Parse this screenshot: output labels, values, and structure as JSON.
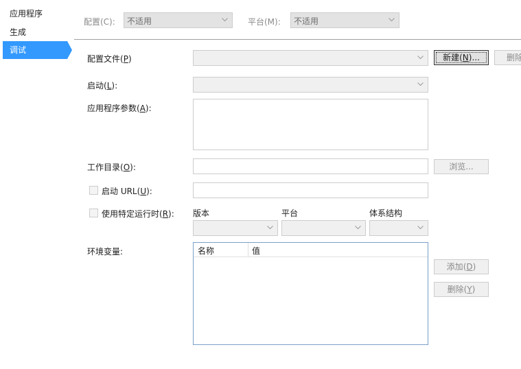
{
  "sidebar": {
    "items": [
      {
        "label": "应用程序",
        "active": false
      },
      {
        "label": "生成",
        "active": false
      },
      {
        "label": "调试",
        "active": true
      }
    ]
  },
  "top": {
    "config_label": "配置(C):",
    "config_value": "不适用",
    "platform_label": "平台(M):",
    "platform_value": "不适用"
  },
  "profile": {
    "label": "配置文件",
    "accel": "P",
    "value": "",
    "new_button": "新建",
    "new_accel": "N",
    "new_suffix": "...",
    "delete_button": "删除"
  },
  "launch": {
    "label": "启动",
    "accel": "L",
    "value": ""
  },
  "app_args": {
    "label": "应用程序参数",
    "accel": "A",
    "value": ""
  },
  "workdir": {
    "label": "工作目录",
    "accel": "O",
    "value": "",
    "browse_button": "浏览..."
  },
  "launch_url": {
    "label": "启动 URL",
    "accel": "U",
    "checked": false,
    "value": ""
  },
  "runtime": {
    "label": "使用特定运行时",
    "accel": "R",
    "checked": false,
    "version_label": "版本",
    "platform_label": "平台",
    "arch_label": "体系结构"
  },
  "env": {
    "label": "环境变量:",
    "columns": [
      "名称",
      "值"
    ],
    "add_button": "添加",
    "add_accel": "D",
    "delete_button": "删除",
    "delete_accel": "Y"
  },
  "colors": {
    "accent": "#3399ff",
    "disabled_text": "#8a8a8a"
  }
}
